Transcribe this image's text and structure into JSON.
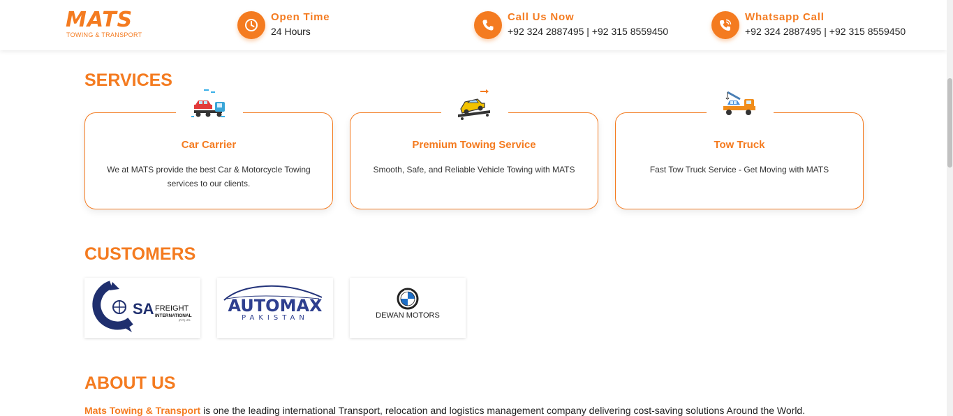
{
  "header": {
    "logo": {
      "main": "MATS",
      "sub": "TOWING & TRANSPORT"
    },
    "open_time": {
      "icon": "clock-icon",
      "title": "Open Time",
      "value": "24 Hours"
    },
    "call": {
      "icon": "phone-icon",
      "title": "Call Us Now",
      "value": "+92 324 2887495 | +92 315 8559450"
    },
    "whatsapp": {
      "icon": "phone-wifi-icon",
      "title": "Whatsapp Call",
      "value": "+92 324 2887495 | +92 315 8559450"
    }
  },
  "services": {
    "title": "SERVICES",
    "items": [
      {
        "icon": "car-carrier-truck-icon",
        "title": "Car Carrier",
        "description": "We at MATS provide the best Car & Motorcycle Towing services to our clients."
      },
      {
        "icon": "towing-car-icon",
        "title": "Premium Towing Service",
        "description": "Smooth, Safe, and Reliable Vehicle Towing with MATS"
      },
      {
        "icon": "tow-truck-crane-icon",
        "title": "Tow Truck",
        "description": "Fast Tow Truck Service - Get Moving with MATS"
      }
    ]
  },
  "customers": {
    "title": "CUSTOMERS",
    "logos": [
      {
        "name": "SA Freight International",
        "text_main": "SA",
        "text_line1": "FREIGHT",
        "text_line2": "INTERNATIONAL",
        "text_small": "(PVT) LTD."
      },
      {
        "name": "Automax Pakistan",
        "text_main": "AUTOMAX",
        "text_sub": "PAKISTAN"
      },
      {
        "name": "Dewan Motors",
        "text_main": "DEWAN MOTORS",
        "badge": "BMW"
      }
    ]
  },
  "about": {
    "title": "ABOUT US",
    "brand": "Mats Towing & Transport",
    "text": " is one the leading international Transport, relocation and logistics management company delivering cost-saving solutions Around the World."
  },
  "colors": {
    "accent": "#f47b20",
    "text": "#222222",
    "navy": "#1f2f6e"
  }
}
